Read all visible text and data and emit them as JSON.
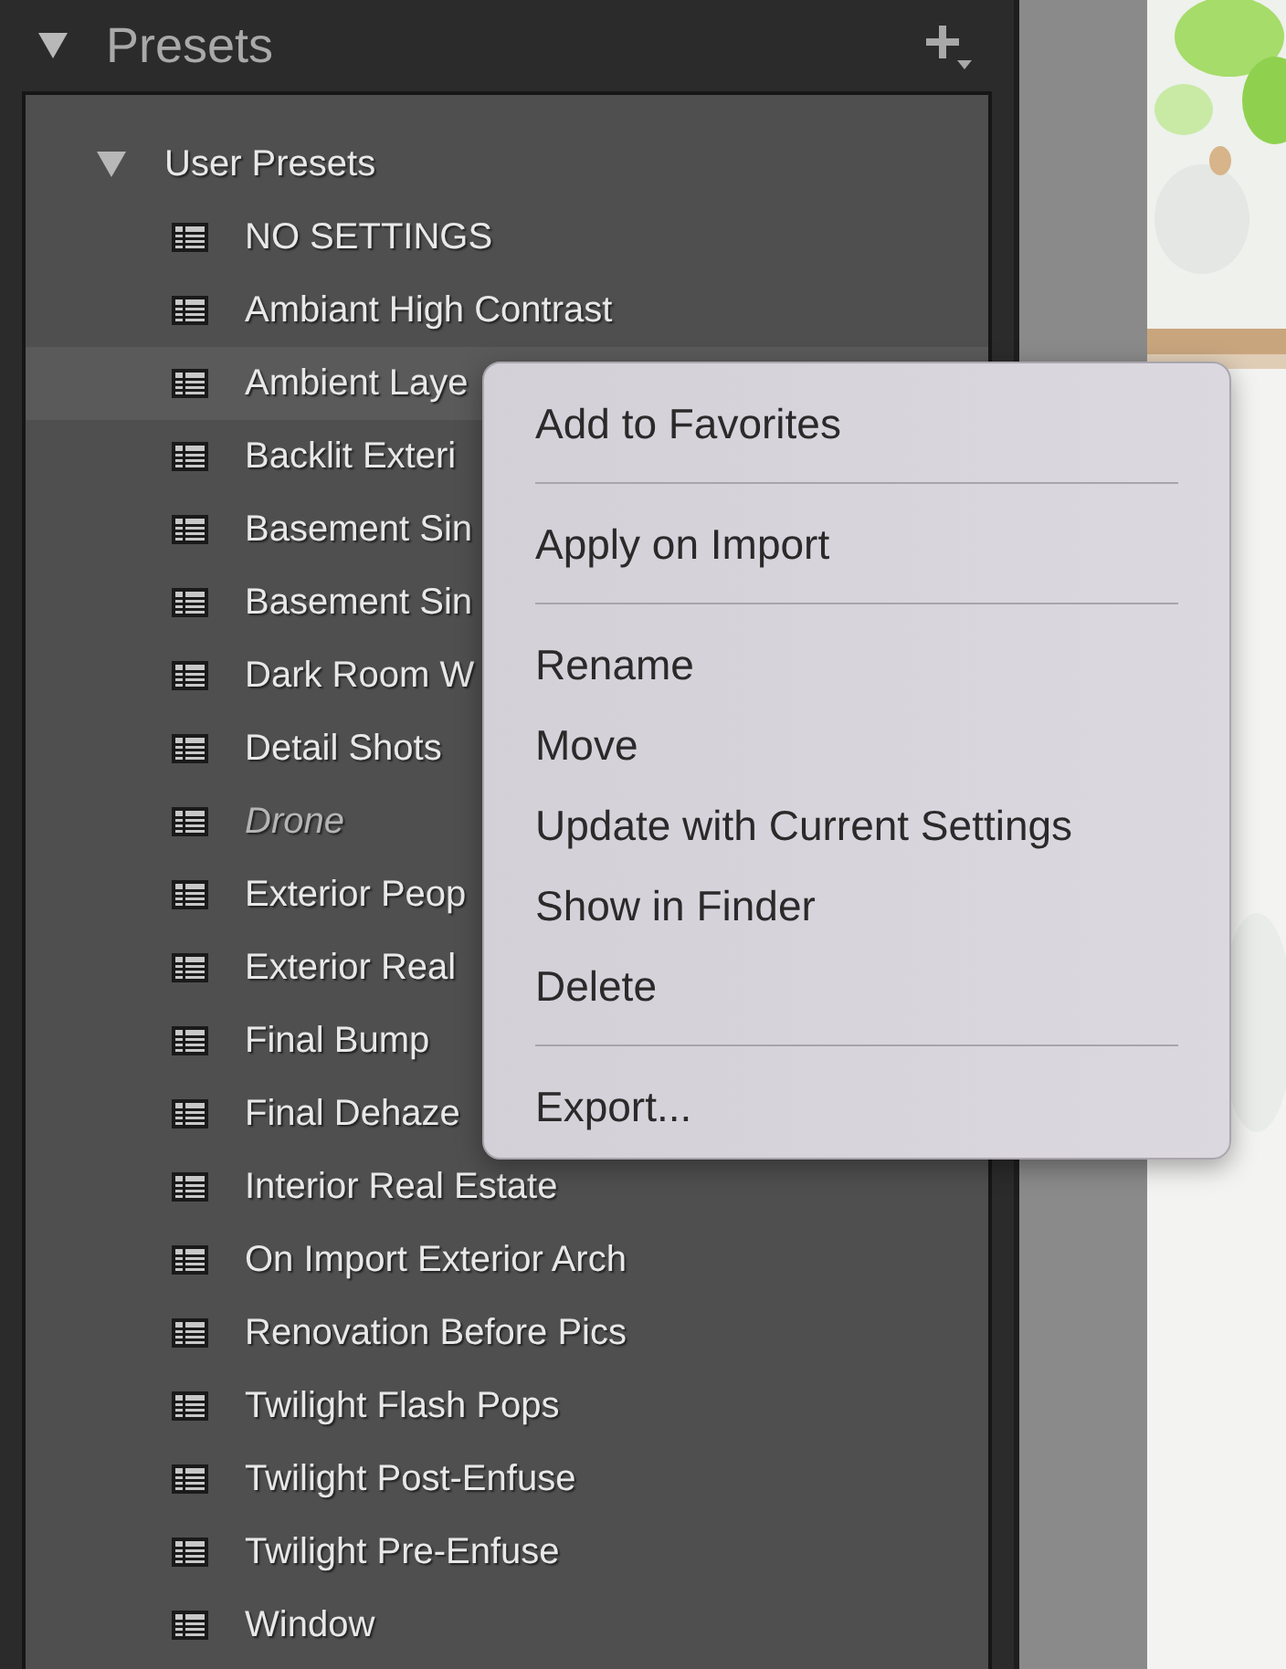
{
  "panel": {
    "title": "Presets",
    "expanded": true
  },
  "groups": [
    {
      "label": "User Presets",
      "expanded": true,
      "children": [
        {
          "label": " NO SETTINGS",
          "selected": false,
          "dimmed": false
        },
        {
          "label": "Ambiant High Contrast",
          "selected": false,
          "dimmed": false
        },
        {
          "label": "Ambient Laye",
          "selected": true,
          "dimmed": false
        },
        {
          "label": "Backlit Exteri",
          "selected": false,
          "dimmed": false
        },
        {
          "label": "Basement Sin",
          "selected": false,
          "dimmed": false
        },
        {
          "label": "Basement Sin",
          "selected": false,
          "dimmed": false
        },
        {
          "label": "Dark Room W",
          "selected": false,
          "dimmed": false
        },
        {
          "label": "Detail Shots",
          "selected": false,
          "dimmed": false
        },
        {
          "label": "Drone",
          "selected": false,
          "dimmed": true
        },
        {
          "label": "Exterior Peop",
          "selected": false,
          "dimmed": false
        },
        {
          "label": "Exterior Real",
          "selected": false,
          "dimmed": false
        },
        {
          "label": "Final Bump",
          "selected": false,
          "dimmed": false
        },
        {
          "label": "Final Dehaze",
          "selected": false,
          "dimmed": false
        },
        {
          "label": "Interior Real Estate",
          "selected": false,
          "dimmed": false
        },
        {
          "label": "On Import Exterior Arch",
          "selected": false,
          "dimmed": false
        },
        {
          "label": "Renovation Before Pics",
          "selected": false,
          "dimmed": false
        },
        {
          "label": "Twilight Flash Pops",
          "selected": false,
          "dimmed": false
        },
        {
          "label": "Twilight Post-Enfuse",
          "selected": false,
          "dimmed": false
        },
        {
          "label": "Twilight Pre-Enfuse",
          "selected": false,
          "dimmed": false
        },
        {
          "label": "Window",
          "selected": false,
          "dimmed": false
        }
      ]
    }
  ],
  "context_menu": [
    {
      "kind": "item",
      "label": "Add to Favorites"
    },
    {
      "kind": "separator"
    },
    {
      "kind": "item",
      "label": "Apply on Import"
    },
    {
      "kind": "separator"
    },
    {
      "kind": "item",
      "label": "Rename"
    },
    {
      "kind": "item",
      "label": "Move"
    },
    {
      "kind": "item",
      "label": "Update with Current Settings"
    },
    {
      "kind": "item",
      "label": "Show in Finder"
    },
    {
      "kind": "item",
      "label": "Delete"
    },
    {
      "kind": "separator"
    },
    {
      "kind": "item",
      "label": "Export..."
    }
  ]
}
